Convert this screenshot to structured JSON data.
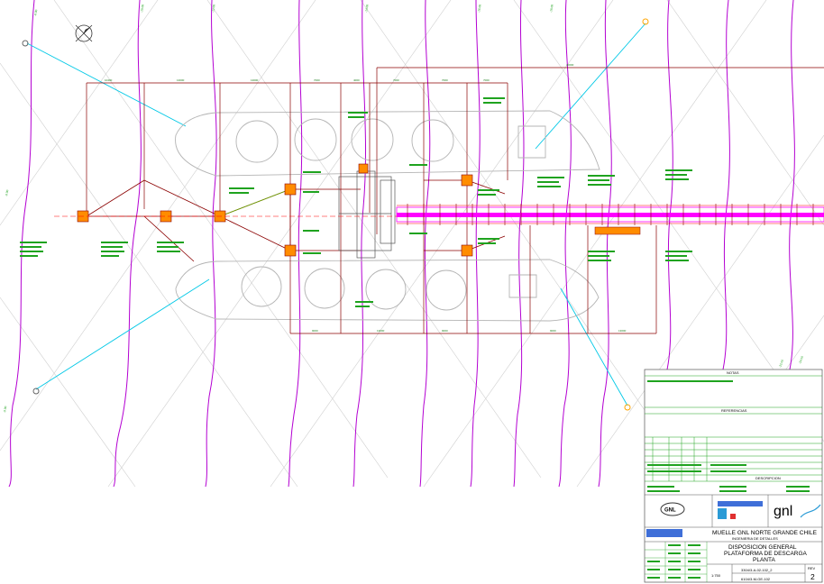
{
  "title_block": {
    "project_line1": "MUELLE GNL NORTE GRANDE CHILE",
    "project_line2": "INGENIERIA DE DETALLES",
    "drawing_line1": "DISPOSICION GENERAL",
    "drawing_line2": "PLATAFORMA DE DESCARGA",
    "drawing_line3": "PLANTA",
    "scale": "1:750",
    "drawing_no_1": "3304/3-A-02-102_2",
    "drawing_no_2": "6104/3-M-GE-102",
    "revision_label": "REV",
    "revision": "2",
    "client_logo": "GNL",
    "logo_left": "gnl",
    "notes_header": "NOTAS",
    "references_header": "REFERENCIAS",
    "revisions_header": "DESCRIPCION"
  },
  "colors": {
    "contour": "#b400d2",
    "trestle": "#ff00ff",
    "grid": "#c9c9c9",
    "structure": "#8b0000",
    "mooring_line": "#00c8e6",
    "labels": "#1fa31f",
    "vessel": "#b4b4b4"
  },
  "icons": {
    "north_arrow": "north-arrow-icon",
    "dolphin": "dolphin-icon"
  }
}
